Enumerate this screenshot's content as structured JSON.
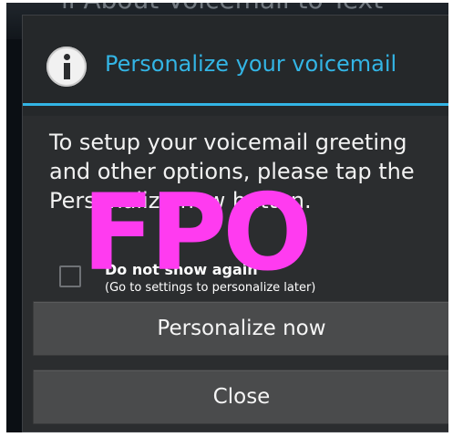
{
  "background": {
    "peek_text": "ll About Voicemail to Text"
  },
  "dialog": {
    "title": "Personalize your voicemail",
    "icon": "info-icon",
    "message": "To setup your voicemail greeting and other options, please tap the Personalize now button.",
    "checkbox": {
      "label": "Do not show again",
      "sublabel": "(Go to settings to personalize later)",
      "checked": false
    },
    "buttons": {
      "personalize": "Personalize now",
      "close": "Close"
    },
    "accent_color": "#33b5e5"
  },
  "overlay": {
    "text": "FPO",
    "color": "#ff3bf0"
  }
}
